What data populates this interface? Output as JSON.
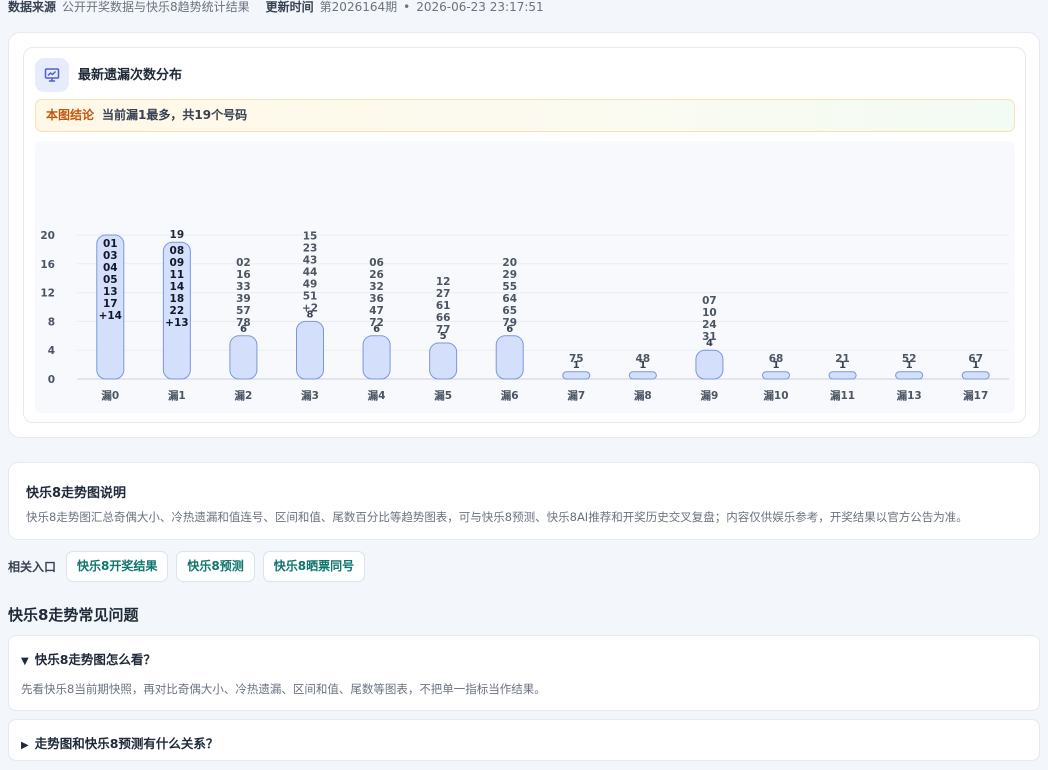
{
  "source_bar": {
    "source_label": "数据来源",
    "source_value": "公开开奖数据与快乐8趋势统计结果",
    "update_label": "更新时间",
    "issue": "第2026164期",
    "separator": "•",
    "datetime": "2026-06-23 23:17:51"
  },
  "chart_card": {
    "icon": "presentation-chart-icon",
    "title": "最新遗漏次数分布",
    "conclusion_tag": "本图结论",
    "conclusion_text": "当前漏1最多，共19个号码"
  },
  "chart_data": {
    "type": "bar",
    "title": "最新遗漏次数分布",
    "categories": [
      "漏0",
      "漏1",
      "漏2",
      "漏3",
      "漏4",
      "漏5",
      "漏6",
      "漏7",
      "漏8",
      "漏9",
      "漏10",
      "漏11",
      "漏13",
      "漏17"
    ],
    "values": [
      20,
      19,
      6,
      8,
      6,
      5,
      6,
      1,
      1,
      4,
      1,
      1,
      1,
      1
    ],
    "value_labels": [
      "20",
      "19",
      "6",
      "8",
      "6",
      "5",
      "6",
      "1",
      "1",
      "4",
      "1",
      "1",
      "1",
      "1"
    ],
    "numbers": [
      [
        "01",
        "03",
        "04",
        "05",
        "13",
        "17",
        "+14"
      ],
      [
        "08",
        "09",
        "11",
        "14",
        "18",
        "22",
        "+13"
      ],
      [
        "02",
        "16",
        "33",
        "39",
        "57",
        "78"
      ],
      [
        "15",
        "23",
        "43",
        "44",
        "49",
        "51",
        "+2"
      ],
      [
        "06",
        "26",
        "32",
        "36",
        "47",
        "72"
      ],
      [
        "12",
        "27",
        "61",
        "66",
        "77"
      ],
      [
        "20",
        "29",
        "55",
        "64",
        "65",
        "79"
      ],
      [
        "75"
      ],
      [
        "48"
      ],
      [
        "07",
        "10",
        "24",
        "31"
      ],
      [
        "68"
      ],
      [
        "21"
      ],
      [
        "52"
      ],
      [
        "67"
      ]
    ],
    "y_ticks": [
      0,
      4,
      8,
      12,
      16,
      20
    ],
    "ylim": [
      0,
      20
    ],
    "grid": true,
    "bar_color": "#d4e0fb",
    "bar_border": "#7a96df"
  },
  "explain": {
    "title": "快乐8走势图说明",
    "text": "快乐8走势图汇总奇偶大小、冷热遗漏和值连号、区间和值、尾数百分比等趋势图表，可与快乐8预测、快乐8AI推荐和开奖历史交叉复盘；内容仅供娱乐参考，开奖结果以官方公告为准。"
  },
  "related": {
    "label": "相关入口",
    "links": [
      "快乐8开奖结果",
      "快乐8预测",
      "快乐8晒票同号"
    ]
  },
  "faq": {
    "title": "快乐8走势常见问题",
    "items": [
      {
        "arrow": "▼",
        "question": "快乐8走势图怎么看？",
        "answer": "先看快乐8当前期快照，再对比奇偶大小、冷热遗漏、区间和值、尾数等图表，不把单一指标当作结果。"
      },
      {
        "arrow": "▶",
        "question": "走势图和快乐8预测有什么关系？"
      }
    ]
  }
}
